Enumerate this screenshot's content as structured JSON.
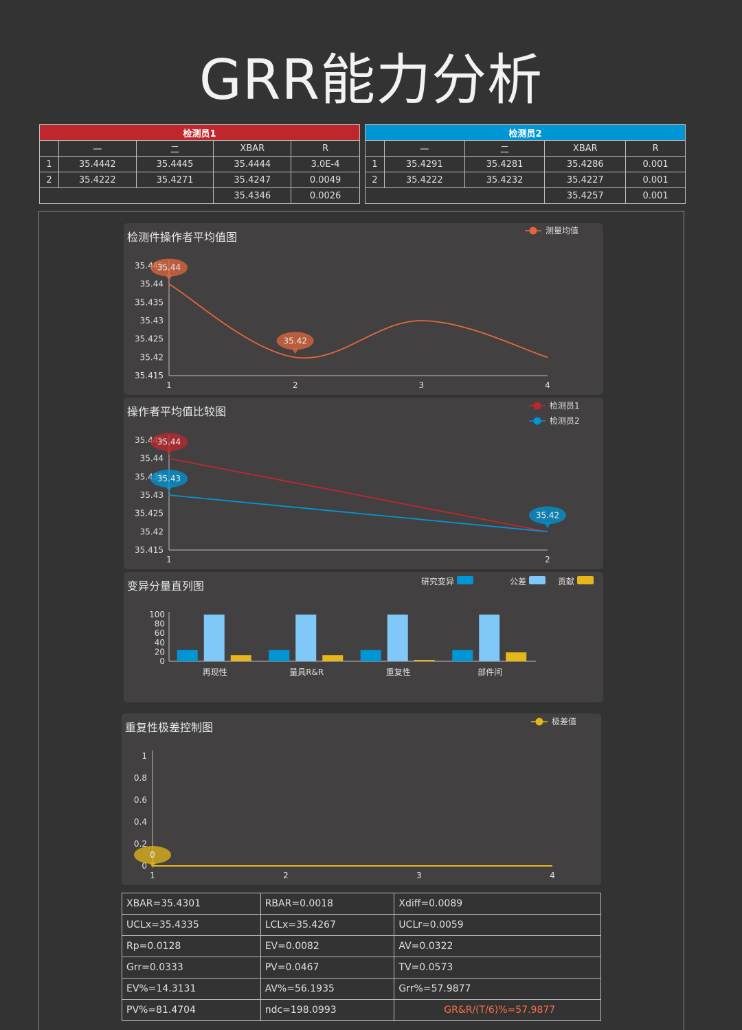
{
  "page": {
    "title": "GRR能力分析"
  },
  "colors": {
    "inspector1": "#c0272d",
    "inspector2": "#0096d6",
    "orange": "#e2683c",
    "light_blue": "#7fc8f8",
    "gold": "#e6b719",
    "highlight_text": "#ff7043"
  },
  "inspector1": {
    "title": "检测员1",
    "headers": [
      "",
      "一",
      "二",
      "XBAR",
      "R"
    ],
    "rows": [
      [
        "1",
        "35.4442",
        "35.4445",
        "35.4444",
        "3.0E-4"
      ],
      [
        "2",
        "35.4222",
        "35.4271",
        "35.4247",
        "0.0049"
      ]
    ],
    "summary": [
      "35.4346",
      "0.0026"
    ]
  },
  "inspector2": {
    "title": "检测员2",
    "headers": [
      "",
      "一",
      "二",
      "XBAR",
      "R"
    ],
    "rows": [
      [
        "1",
        "35.4291",
        "35.4281",
        "35.4286",
        "0.001"
      ],
      [
        "2",
        "35.4222",
        "35.4232",
        "35.4227",
        "0.001"
      ]
    ],
    "summary": [
      "35.4257",
      "0.001"
    ]
  },
  "chart_data": [
    {
      "type": "line",
      "title": "检测件操作者平均值图",
      "x": [
        "1",
        "2",
        "3",
        "4"
      ],
      "ylim": [
        35.415,
        35.445
      ],
      "yticks": [
        "35.415",
        "35.42",
        "35.425",
        "35.43",
        "35.435",
        "35.44",
        "35.445"
      ],
      "series": [
        {
          "name": "测量均值",
          "values": [
            35.44,
            35.42,
            35.43,
            35.42
          ],
          "color": "#e2683c"
        }
      ],
      "callouts": [
        {
          "index": 0,
          "label": "35.44"
        },
        {
          "index": 1,
          "label": "35.42"
        }
      ],
      "legend": "top-right",
      "smooth": true
    },
    {
      "type": "line",
      "title": "操作者平均值比较图",
      "x": [
        "1",
        "2"
      ],
      "ylim": [
        35.415,
        35.445
      ],
      "yticks": [
        "35.415",
        "35.42",
        "35.425",
        "35.43",
        "35.435",
        "35.44",
        "35.445"
      ],
      "series": [
        {
          "name": "检测员1",
          "values": [
            35.44,
            35.42
          ],
          "color": "#c0272d",
          "callouts": [
            {
              "index": 0,
              "label": "35.44"
            }
          ]
        },
        {
          "name": "检测员2",
          "values": [
            35.43,
            35.42
          ],
          "color": "#0096d6",
          "callouts": [
            {
              "index": 0,
              "label": "35.43"
            },
            {
              "index": 1,
              "label": "35.42"
            }
          ]
        }
      ],
      "legend": "top-right"
    },
    {
      "type": "bar",
      "title": "变异分量直列图",
      "categories": [
        "再现性",
        "量具R&R",
        "重复性",
        "部件间"
      ],
      "ylim": [
        0,
        100
      ],
      "yticks": [
        "0",
        "20",
        "40",
        "60",
        "80",
        "100"
      ],
      "series": [
        {
          "name": "研究变异",
          "values": [
            24,
            24,
            24,
            24
          ],
          "color": "#0096d6"
        },
        {
          "name": "公差",
          "values": [
            100,
            100,
            100,
            100
          ],
          "color": "#7fc8f8"
        },
        {
          "name": "贡献",
          "values": [
            13,
            13,
            3,
            19
          ],
          "color": "#e6b719"
        }
      ],
      "legend": "top-right"
    },
    {
      "type": "line",
      "title": "重复性极差控制图",
      "x": [
        "1",
        "2",
        "3",
        "4"
      ],
      "ylim": [
        0,
        1
      ],
      "yticks": [
        "0",
        "0.2",
        "0.4",
        "0.6",
        "0.8",
        "1"
      ],
      "series": [
        {
          "name": "极差值",
          "values": [
            0,
            0,
            0,
            0
          ],
          "color": "#e6b719"
        }
      ],
      "callouts": [
        {
          "index": 0,
          "label": "0"
        }
      ],
      "legend": "top-right"
    }
  ],
  "stats": [
    [
      "XBAR=35.4301",
      "RBAR=0.0018",
      "Xdiff=0.0089"
    ],
    [
      "UCLx=35.4335",
      "LCLx=35.4267",
      "UCLr=0.0059"
    ],
    [
      "Rp=0.0128",
      "EV=0.0082",
      "AV=0.0322"
    ],
    [
      "Grr=0.0333",
      "PV=0.0467",
      "TV=0.0573"
    ],
    [
      "EV%=14.3131",
      "AV%=56.1935",
      "Grr%=57.9877"
    ],
    [
      "PV%=81.4704",
      "ndc=198.0993",
      "GR&R/(T/6)%=57.9877"
    ]
  ]
}
